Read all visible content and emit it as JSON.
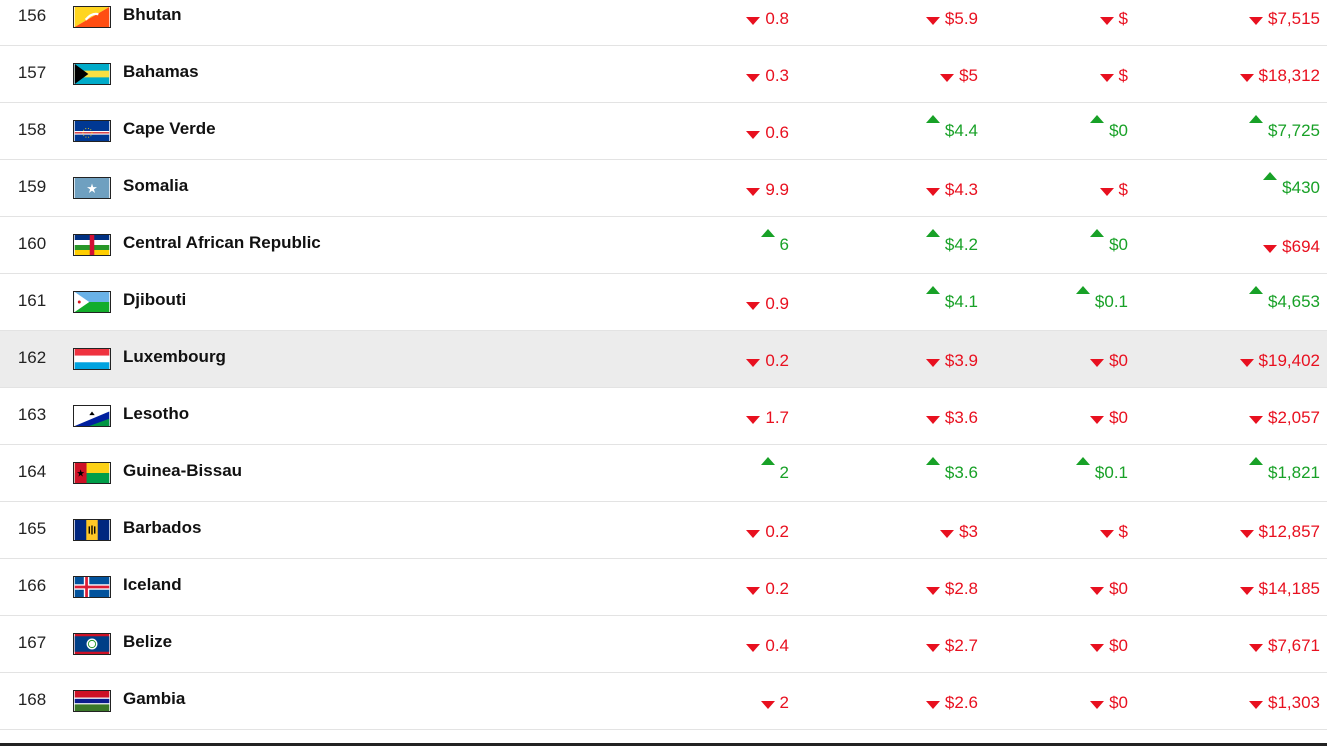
{
  "rows": [
    {
      "rank": "156",
      "flag": "bhutan",
      "name": "Bhutan",
      "c1": {
        "dir": "down",
        "text": "0.8"
      },
      "c2": {
        "dir": "down",
        "text": "$5.9"
      },
      "c3": {
        "dir": "down",
        "text": "$"
      },
      "c4": {
        "dir": "down",
        "text": "$7,515"
      }
    },
    {
      "rank": "157",
      "flag": "bahamas",
      "name": "Bahamas",
      "c1": {
        "dir": "down",
        "text": "0.3"
      },
      "c2": {
        "dir": "down",
        "text": "$5"
      },
      "c3": {
        "dir": "down",
        "text": "$"
      },
      "c4": {
        "dir": "down",
        "text": "$18,312"
      }
    },
    {
      "rank": "158",
      "flag": "cape-verde",
      "name": "Cape Verde",
      "c1": {
        "dir": "down",
        "text": "0.6"
      },
      "c2": {
        "dir": "up",
        "text": "$4.4"
      },
      "c3": {
        "dir": "up",
        "text": "$0"
      },
      "c4": {
        "dir": "up",
        "text": "$7,725"
      }
    },
    {
      "rank": "159",
      "flag": "somalia",
      "name": "Somalia",
      "c1": {
        "dir": "down",
        "text": "9.9"
      },
      "c2": {
        "dir": "down",
        "text": "$4.3"
      },
      "c3": {
        "dir": "down",
        "text": "$"
      },
      "c4": {
        "dir": "up",
        "text": "$430"
      }
    },
    {
      "rank": "160",
      "flag": "car",
      "name": "Central African Republic",
      "c1": {
        "dir": "up",
        "text": "6"
      },
      "c2": {
        "dir": "up",
        "text": "$4.2"
      },
      "c3": {
        "dir": "up",
        "text": "$0"
      },
      "c4": {
        "dir": "down",
        "text": "$694"
      }
    },
    {
      "rank": "161",
      "flag": "djibouti",
      "name": "Djibouti",
      "c1": {
        "dir": "down",
        "text": "0.9"
      },
      "c2": {
        "dir": "up",
        "text": "$4.1"
      },
      "c3": {
        "dir": "up",
        "text": "$0.1"
      },
      "c4": {
        "dir": "up",
        "text": "$4,653"
      }
    },
    {
      "rank": "162",
      "flag": "luxembourg",
      "name": "Luxembourg",
      "highlight": true,
      "c1": {
        "dir": "down",
        "text": "0.2"
      },
      "c2": {
        "dir": "down",
        "text": "$3.9"
      },
      "c3": {
        "dir": "down",
        "text": "$0"
      },
      "c4": {
        "dir": "down",
        "text": "$19,402"
      }
    },
    {
      "rank": "163",
      "flag": "lesotho",
      "name": "Lesotho",
      "c1": {
        "dir": "down",
        "text": "1.7"
      },
      "c2": {
        "dir": "down",
        "text": "$3.6"
      },
      "c3": {
        "dir": "down",
        "text": "$0"
      },
      "c4": {
        "dir": "down",
        "text": "$2,057"
      }
    },
    {
      "rank": "164",
      "flag": "guinea-bissau",
      "name": "Guinea-Bissau",
      "c1": {
        "dir": "up",
        "text": "2"
      },
      "c2": {
        "dir": "up",
        "text": "$3.6"
      },
      "c3": {
        "dir": "up",
        "text": "$0.1"
      },
      "c4": {
        "dir": "up",
        "text": "$1,821"
      }
    },
    {
      "rank": "165",
      "flag": "barbados",
      "name": "Barbados",
      "c1": {
        "dir": "down",
        "text": "0.2"
      },
      "c2": {
        "dir": "down",
        "text": "$3"
      },
      "c3": {
        "dir": "down",
        "text": "$"
      },
      "c4": {
        "dir": "down",
        "text": "$12,857"
      }
    },
    {
      "rank": "166",
      "flag": "iceland",
      "name": "Iceland",
      "c1": {
        "dir": "down",
        "text": "0.2"
      },
      "c2": {
        "dir": "down",
        "text": "$2.8"
      },
      "c3": {
        "dir": "down",
        "text": "$0"
      },
      "c4": {
        "dir": "down",
        "text": "$14,185"
      }
    },
    {
      "rank": "167",
      "flag": "belize",
      "name": "Belize",
      "c1": {
        "dir": "down",
        "text": "0.4"
      },
      "c2": {
        "dir": "down",
        "text": "$2.7"
      },
      "c3": {
        "dir": "down",
        "text": "$0"
      },
      "c4": {
        "dir": "down",
        "text": "$7,671"
      }
    },
    {
      "rank": "168",
      "flag": "gambia",
      "name": "Gambia",
      "c1": {
        "dir": "down",
        "text": "2"
      },
      "c2": {
        "dir": "down",
        "text": "$2.6"
      },
      "c3": {
        "dir": "down",
        "text": "$0"
      },
      "c4": {
        "dir": "down",
        "text": "$1,303"
      }
    }
  ],
  "colors": {
    "up": "#18a127",
    "down": "#e8101f",
    "highlight_row": "#ececec"
  }
}
